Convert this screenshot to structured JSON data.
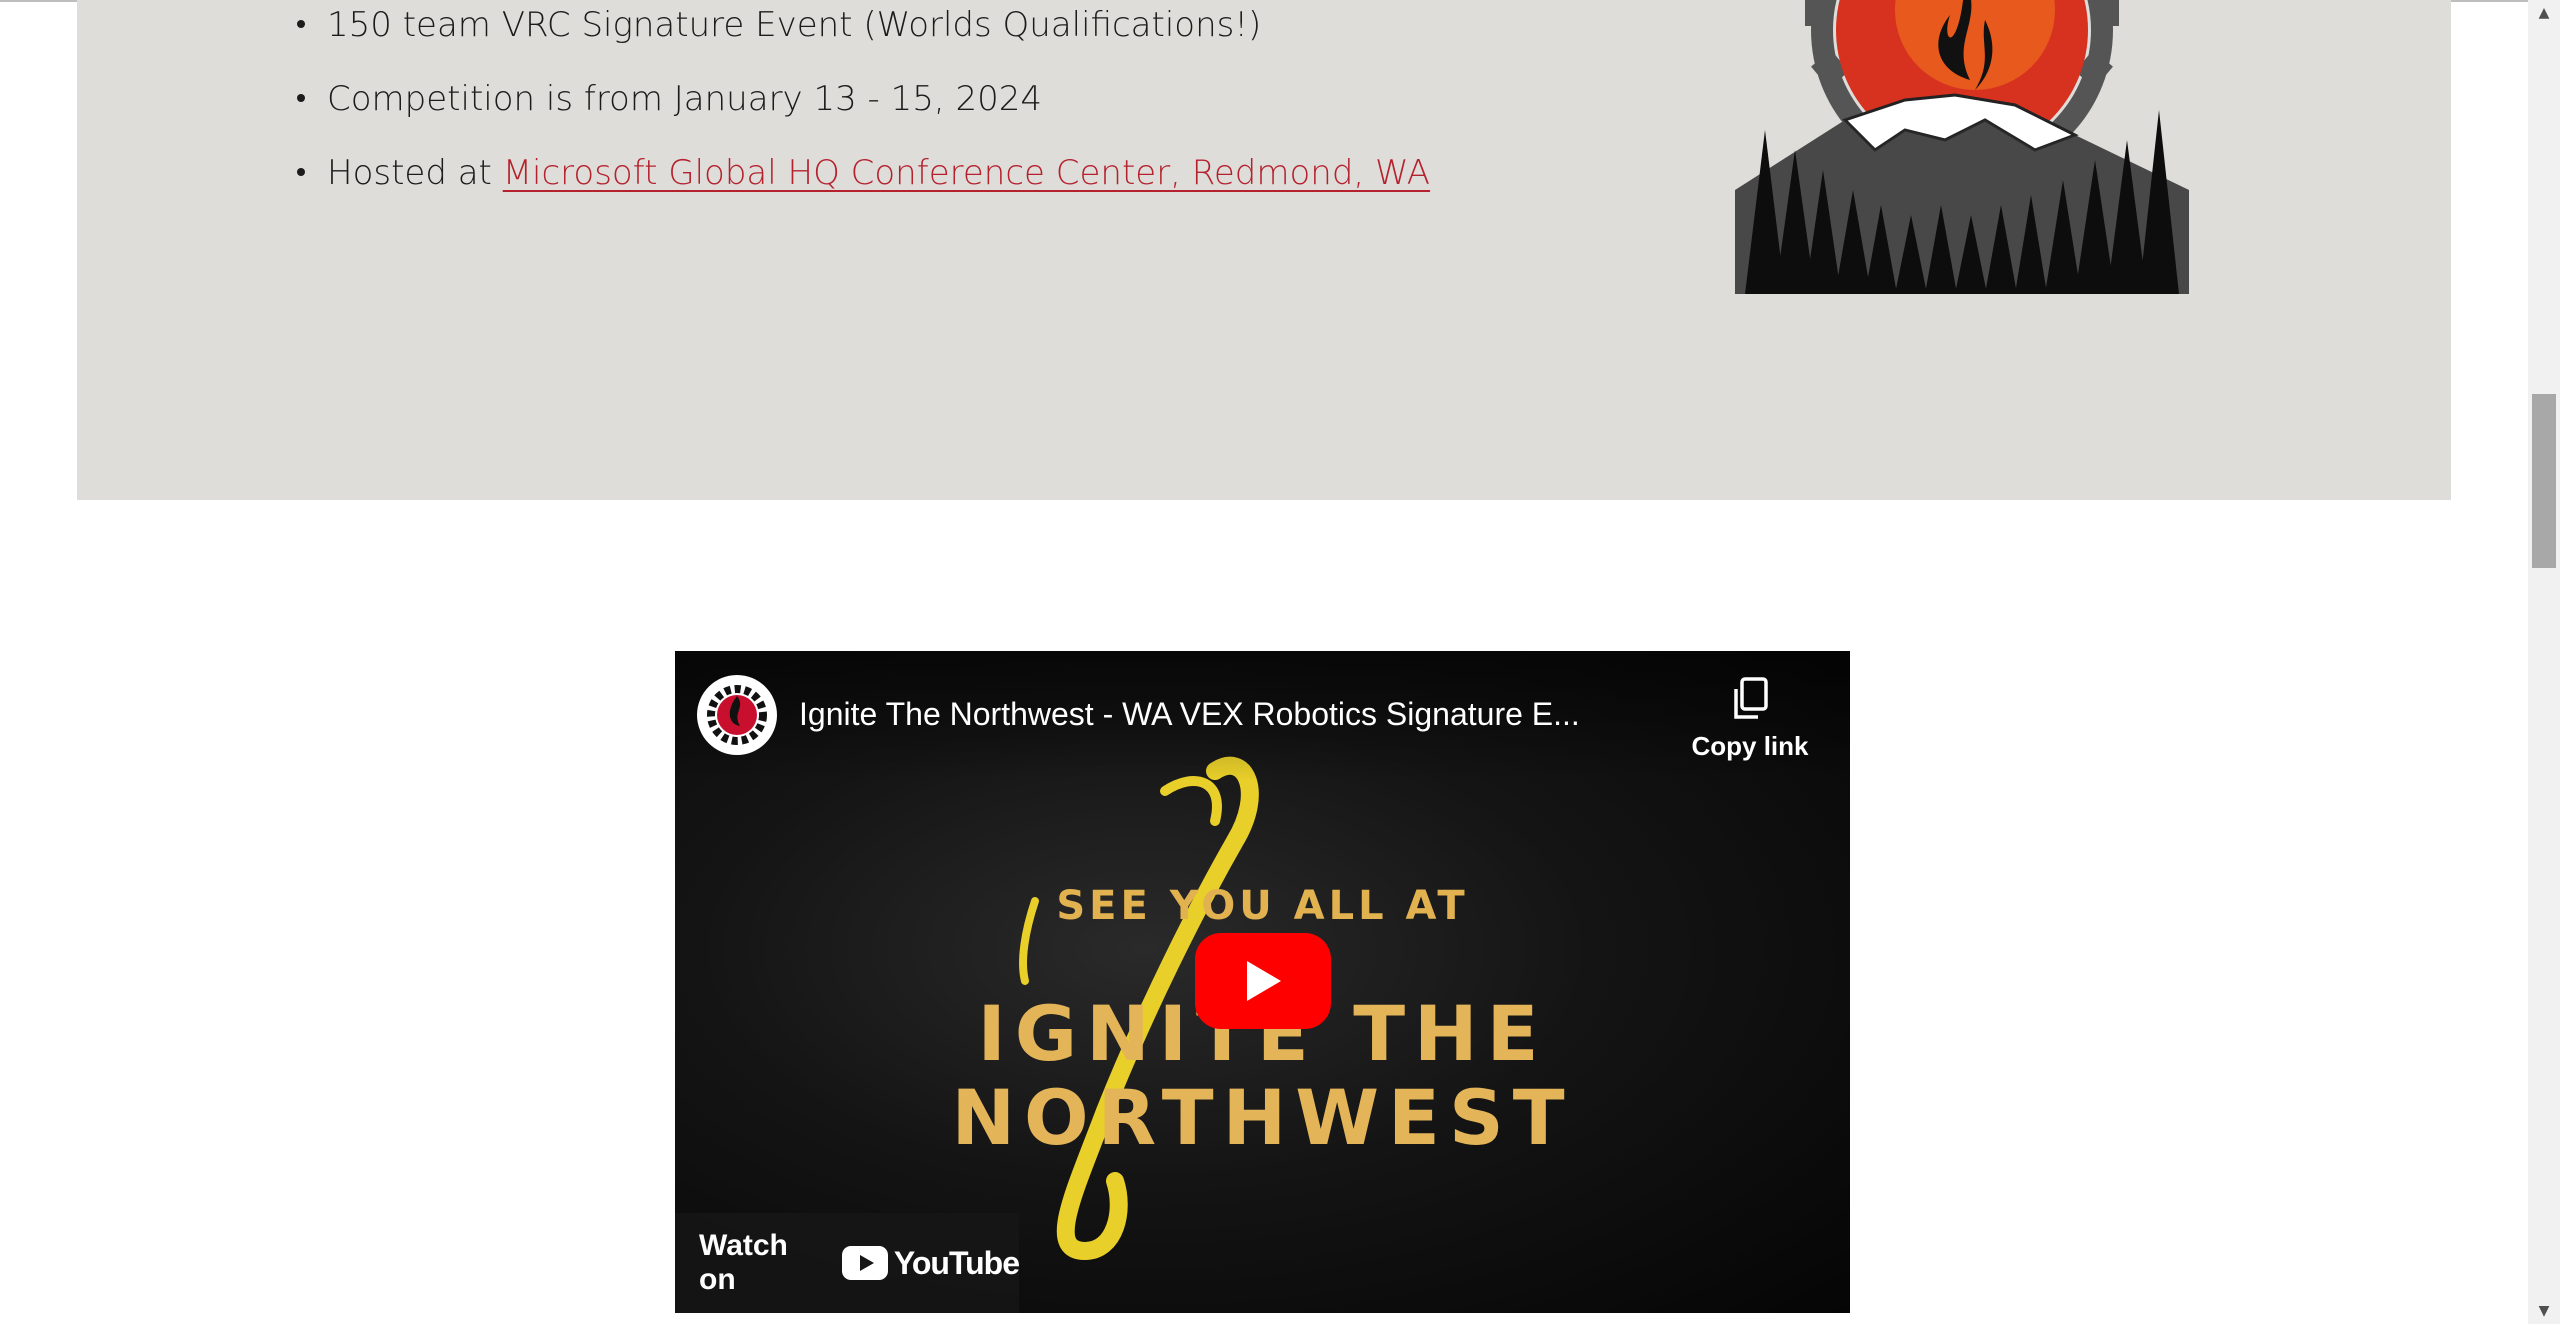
{
  "event_info": {
    "bullets": [
      {
        "text": "150 team VRC Signature Event (Worlds Qualifications!)"
      },
      {
        "text": "Competition is from January 13 - 15, 2024"
      },
      {
        "prefix": "Hosted at ",
        "link_text": "Microsoft Global HQ Conference Center, Redmond, WA"
      }
    ]
  },
  "logo": {
    "icon": "ignite-the-northwest-logo"
  },
  "video": {
    "title": "Ignite The Northwest - WA VEX Robotics Signature E...",
    "copy_link_label": "Copy link",
    "overlay_line_small": "SEE YOU ALL AT",
    "overlay_line_big_1": "IGNITE THE",
    "overlay_line_big_2": "NORTHWEST",
    "watch_on_label": "Watch on",
    "youtube_wordmark": "YouTube",
    "play_icon": "play-icon"
  },
  "colors": {
    "band_background": "#deddd9",
    "link": "#b5222e",
    "accent_gold": "#e4b458",
    "youtube_red": "#ff0000"
  }
}
